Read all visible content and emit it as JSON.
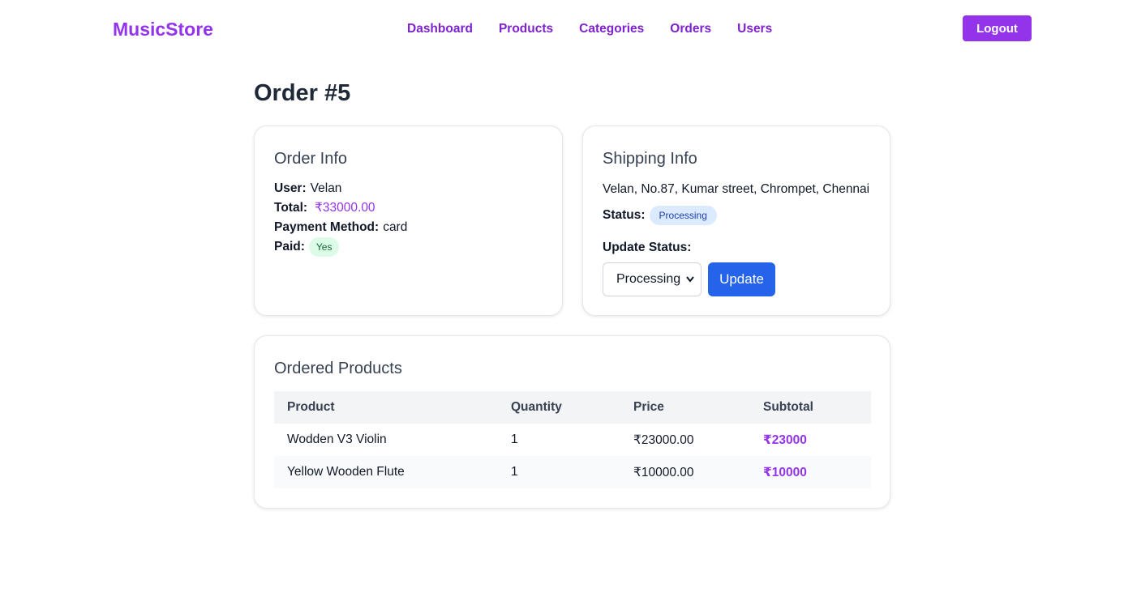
{
  "nav": {
    "brand": "MusicStore",
    "links": [
      "Dashboard",
      "Products",
      "Categories",
      "Orders",
      "Users"
    ],
    "logout": "Logout"
  },
  "page": {
    "title": "Order #5"
  },
  "order_info": {
    "title": "Order Info",
    "user_label": "User:",
    "user": "Velan",
    "total_label": "Total:",
    "total": "₹33000.00",
    "payment_label": "Payment Method:",
    "payment": "card",
    "paid_label": "Paid:",
    "paid": "Yes"
  },
  "shipping_info": {
    "title": "Shipping Info",
    "address": "Velan, No.87, Kumar street, Chrompet, Chennai",
    "status_label": "Status:",
    "status": "Processing",
    "update_label": "Update Status:",
    "select_value": "Processing",
    "update_button": "Update"
  },
  "products": {
    "title": "Ordered Products",
    "headers": [
      "Product",
      "Quantity",
      "Price",
      "Subtotal"
    ],
    "rows": [
      [
        "Wodden V3 Violin",
        "1",
        "₹23000.00",
        "₹23000"
      ],
      [
        "Yellow Wooden Flute",
        "1",
        "₹10000.00",
        "₹10000"
      ]
    ]
  },
  "colors": {
    "brand": "#9333ea",
    "primary_button": "#2563eb",
    "paid_badge_bg": "#dcfce7",
    "status_badge_bg": "#dbeafe"
  }
}
